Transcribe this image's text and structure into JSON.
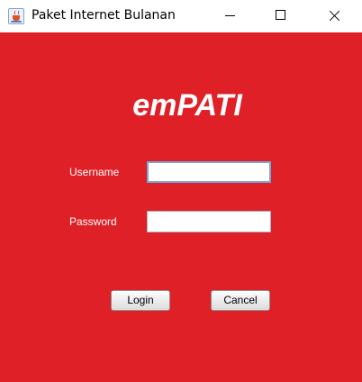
{
  "window": {
    "title": "Paket Internet Bulanan",
    "icon": "java-cup-icon"
  },
  "titlebar_buttons": {
    "minimize": "minimize-icon",
    "maximize": "maximize-icon",
    "close": "close-icon"
  },
  "colors": {
    "background": "#e02027",
    "text": "#ffffff"
  },
  "form": {
    "brand": "emPATI",
    "username_label": "Username",
    "username_value": "",
    "password_label": "Password",
    "password_value": "",
    "login_label": "Login",
    "cancel_label": "Cancel"
  }
}
